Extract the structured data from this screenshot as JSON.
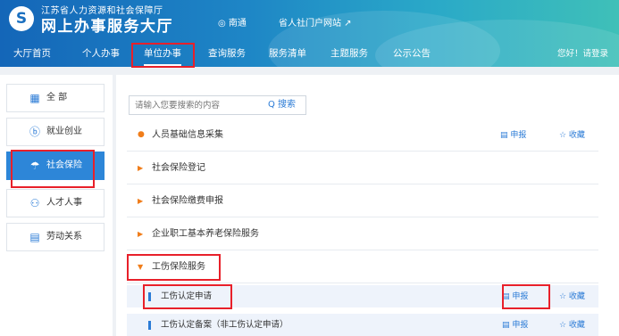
{
  "header": {
    "org_name": "江苏省人力资源和社会保障厅",
    "site_name": "网上办事服务大厅",
    "location": "◎ 南通",
    "province_link": "省人社门户网站 ↗",
    "login": "您好！请登录"
  },
  "nav": [
    {
      "label": "大厅首页"
    },
    {
      "label": "个人办事"
    },
    {
      "label": "单位办事"
    },
    {
      "label": "查询服务"
    },
    {
      "label": "服务清单"
    },
    {
      "label": "主题服务"
    },
    {
      "label": "公示公告"
    }
  ],
  "sidebar": [
    {
      "label": "全 部",
      "icon": "grid-icon"
    },
    {
      "label": "就业创业",
      "icon": "employment-icon"
    },
    {
      "label": "社会保险",
      "icon": "umbrella-icon"
    },
    {
      "label": "人才人事",
      "icon": "people-icon"
    },
    {
      "label": "劳动关系",
      "icon": "labor-document-icon"
    }
  ],
  "search": {
    "placeholder": "请输入您要搜索的内容",
    "button": "Q 搜索"
  },
  "services": [
    {
      "title": "人员基础信息采集"
    },
    {
      "title": "社会保险登记"
    },
    {
      "title": "社会保险缴费申报"
    },
    {
      "title": "企业职工基本养老保险服务"
    },
    {
      "title": "工伤保险服务"
    }
  ],
  "sub_services": [
    {
      "title": "工伤认定申请"
    },
    {
      "title": "工伤认定备案（非工伤认定申请）"
    }
  ],
  "actions": {
    "apply": "▤ 申报",
    "favorite": "☆ 收藏"
  },
  "colors": {
    "accent": "#2b7bd6",
    "active_sidebar": "#2d86d8",
    "highlight": "#e8202a",
    "marker": "#f07d1a"
  }
}
